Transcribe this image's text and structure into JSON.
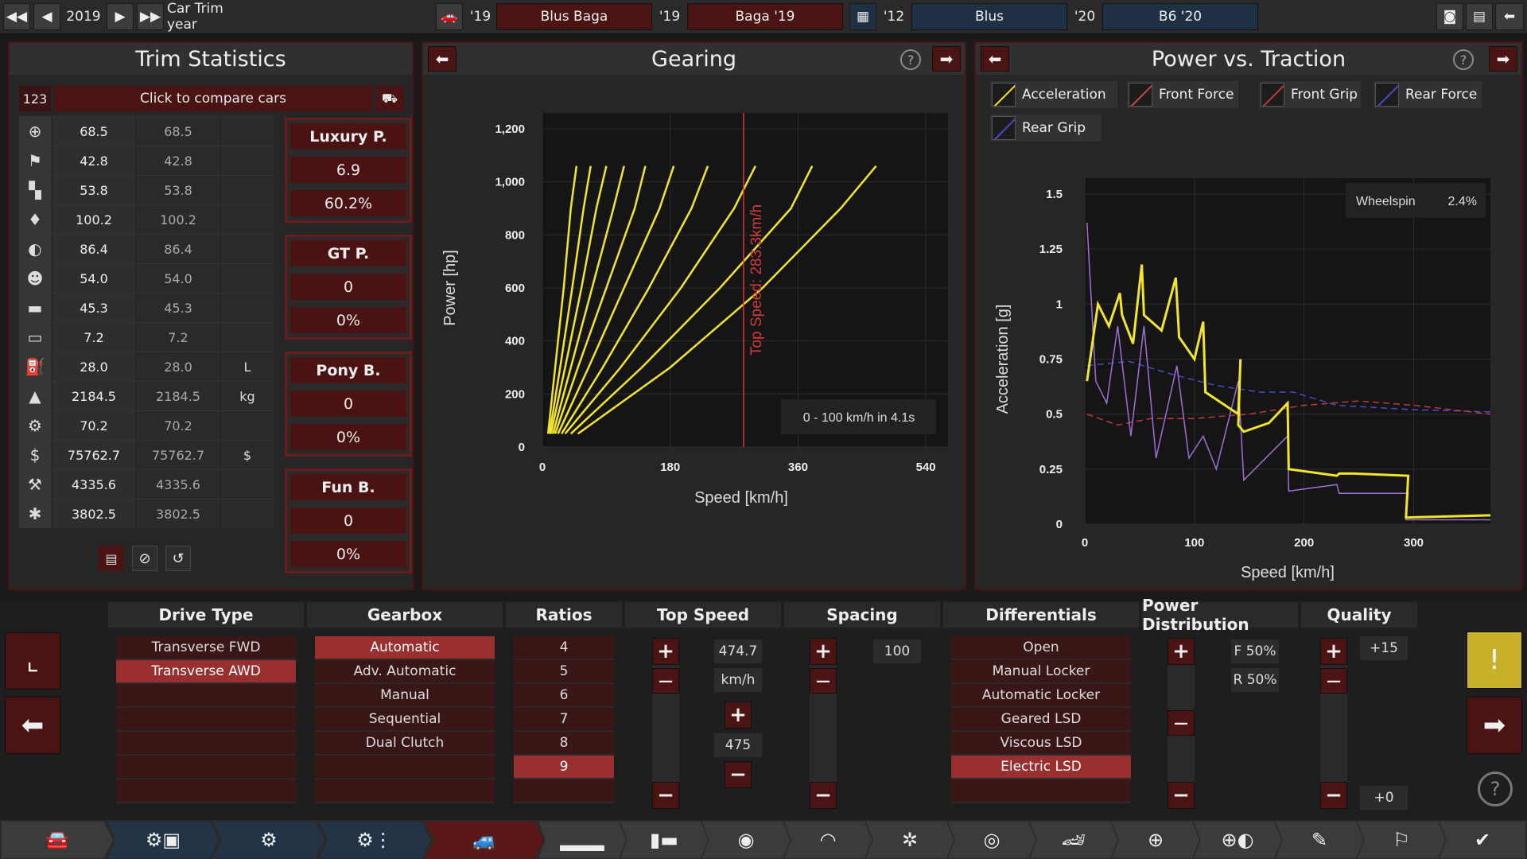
{
  "topbar": {
    "year": "2019",
    "year_label": "Car Trim year",
    "car_year_a": "'19",
    "model": "Blus Baga",
    "trim_year_a": "'19",
    "trim": "Baga '19",
    "engine_year": "'12",
    "engine_family": "Blus",
    "engine_variant_year": "'20",
    "engine_variant": "B6 '20"
  },
  "trim_stats": {
    "title": "Trim Statistics",
    "compare_id": "123",
    "compare_label": "Click to compare cars",
    "rows": [
      {
        "icon": "steering-wheel-icon",
        "glyph": "⊕",
        "v1": "68.5",
        "v2": "68.5",
        "unit": ""
      },
      {
        "icon": "race-flag-icon",
        "glyph": "⚑",
        "v1": "42.8",
        "v2": "42.8",
        "unit": ""
      },
      {
        "icon": "seat-icon",
        "glyph": "▚",
        "v1": "53.8",
        "v2": "53.8",
        "unit": ""
      },
      {
        "icon": "diamond-icon",
        "glyph": "♦",
        "v1": "100.2",
        "v2": "100.2",
        "unit": ""
      },
      {
        "icon": "safety-icon",
        "glyph": "◐",
        "v1": "86.4",
        "v2": "86.4",
        "unit": ""
      },
      {
        "icon": "passengers-icon",
        "glyph": "☻",
        "v1": "54.0",
        "v2": "54.0",
        "unit": ""
      },
      {
        "icon": "cargo-car-icon",
        "glyph": "▬",
        "v1": "45.3",
        "v2": "45.3",
        "unit": ""
      },
      {
        "icon": "offroad-car-icon",
        "glyph": "▭",
        "v1": "7.2",
        "v2": "7.2",
        "unit": ""
      },
      {
        "icon": "fuel-icon",
        "glyph": "⛽",
        "v1": "28.0",
        "v2": "28.0",
        "unit": "L"
      },
      {
        "icon": "weight-icon",
        "glyph": "▲",
        "v1": "2184.5",
        "v2": "2184.5",
        "unit": "kg"
      },
      {
        "icon": "service-icon",
        "glyph": "⚙",
        "v1": "70.2",
        "v2": "70.2",
        "unit": ""
      },
      {
        "icon": "cost-icon",
        "glyph": "$",
        "v1": "75762.7",
        "v2": "75762.7",
        "unit": "$"
      },
      {
        "icon": "production-icon",
        "glyph": "⚒",
        "v1": "4335.6",
        "v2": "4335.6",
        "unit": ""
      },
      {
        "icon": "engineering-icon",
        "glyph": "✱",
        "v1": "3802.5",
        "v2": "3802.5",
        "unit": ""
      }
    ],
    "categories": [
      {
        "name": "Luxury P.",
        "value": "6.9",
        "pct": "60.2%"
      },
      {
        "name": "GT P.",
        "value": "0",
        "pct": "0%"
      },
      {
        "name": "Pony B.",
        "value": "0",
        "pct": "0%"
      },
      {
        "name": "Fun B.",
        "value": "0",
        "pct": "0%"
      }
    ]
  },
  "gearing": {
    "title": "Gearing",
    "info": "0 - 100 km/h in 4.1s",
    "top_speed_label": "Top Speed: 283.3km/h"
  },
  "traction": {
    "title": "Power vs. Traction",
    "wheelspin_label": "Wheelspin",
    "wheelspin_value": "2.4%"
  },
  "chart_data": [
    {
      "type": "line",
      "title": "Gearing",
      "xlabel": "Speed [km/h]",
      "ylabel": "Power [hp]",
      "xlim": [
        0,
        560
      ],
      "ylim": [
        0,
        1200
      ],
      "xticks": [
        "0",
        "180",
        "360",
        "540"
      ],
      "yticks": [
        "0",
        "200",
        "400",
        "600",
        "800",
        "1,000",
        "1,200"
      ],
      "top_speed_line": 283.3,
      "series_color": "#f2e52a",
      "series": [
        {
          "x": [
            8,
            18,
            30,
            40,
            48
          ],
          "y": [
            50,
            300,
            600,
            900,
            1060
          ]
        },
        {
          "x": [
            10,
            25,
            42,
            58,
            68
          ],
          "y": [
            50,
            300,
            600,
            900,
            1060
          ]
        },
        {
          "x": [
            12,
            32,
            55,
            76,
            90
          ],
          "y": [
            50,
            300,
            600,
            900,
            1060
          ]
        },
        {
          "x": [
            15,
            40,
            70,
            100,
            115
          ],
          "y": [
            50,
            300,
            600,
            900,
            1060
          ]
        },
        {
          "x": [
            18,
            50,
            90,
            130,
            145
          ],
          "y": [
            50,
            300,
            600,
            900,
            1060
          ]
        },
        {
          "x": [
            22,
            65,
            115,
            165,
            185
          ],
          "y": [
            50,
            300,
            600,
            900,
            1060
          ]
        },
        {
          "x": [
            27,
            85,
            150,
            210,
            233
          ],
          "y": [
            50,
            300,
            600,
            900,
            1060
          ]
        },
        {
          "x": [
            32,
            110,
            195,
            270,
            300
          ],
          "y": [
            50,
            300,
            600,
            900,
            1060
          ]
        },
        {
          "x": [
            40,
            140,
            250,
            350,
            380
          ],
          "y": [
            50,
            300,
            600,
            900,
            1060
          ]
        },
        {
          "x": [
            50,
            180,
            310,
            420,
            470
          ],
          "y": [
            50,
            300,
            600,
            900,
            1060
          ]
        }
      ]
    },
    {
      "type": "line",
      "title": "Power vs. Traction",
      "xlabel": "Speed [km/h]",
      "ylabel": "Acceleration [g]",
      "xlim": [
        0,
        370
      ],
      "ylim": [
        0,
        1.5
      ],
      "xticks": [
        "0",
        "100",
        "200",
        "300"
      ],
      "yticks": [
        "0",
        "0.25",
        "0.5",
        "0.75",
        "1",
        "1.25",
        "1.5"
      ],
      "legend": [
        {
          "name": "Acceleration",
          "color": "#f2e52a"
        },
        {
          "name": "Front Force",
          "color": "#d04545"
        },
        {
          "name": "Front Grip",
          "color": "#c03a3a"
        },
        {
          "name": "Rear Force",
          "color": "#4a4ad0"
        },
        {
          "name": "Rear Grip",
          "color": "#4a4ad0"
        }
      ],
      "series": [
        {
          "name": "Acceleration",
          "color": "#f2e52a",
          "x": [
            2,
            12,
            22,
            32,
            34,
            44,
            52,
            54,
            70,
            83,
            86,
            100,
            108,
            110,
            140,
            142,
            140,
            145,
            168,
            185,
            186,
            230,
            232,
            245,
            295,
            293,
            370
          ],
          "y": [
            0.65,
            1.0,
            0.9,
            1.05,
            0.95,
            0.82,
            1.18,
            0.95,
            0.88,
            1.12,
            0.85,
            0.75,
            0.92,
            0.6,
            0.5,
            0.75,
            0.45,
            0.42,
            0.46,
            0.55,
            0.25,
            0.22,
            0.23,
            0.23,
            0.22,
            0.03,
            0.04
          ]
        },
        {
          "name": "Rear Grip",
          "color": "#4a4ad0",
          "x": [
            2,
            40,
            80,
            120,
            160,
            190,
            230,
            300,
            370
          ],
          "y": [
            0.72,
            0.74,
            0.68,
            0.63,
            0.6,
            0.6,
            0.54,
            0.52,
            0.51
          ]
        },
        {
          "name": "Front Grip",
          "color": "#c03a3a",
          "x": [
            2,
            30,
            60,
            100,
            150,
            200,
            250,
            300,
            370
          ],
          "y": [
            0.5,
            0.45,
            0.48,
            0.48,
            0.5,
            0.54,
            0.56,
            0.54,
            0.5
          ]
        },
        {
          "name": "Rear Force",
          "color": "#9f6fd8",
          "x": [
            2,
            10,
            20,
            30,
            42,
            54,
            65,
            84,
            95,
            108,
            120,
            140,
            145,
            185,
            186,
            230,
            232,
            295,
            293,
            370
          ],
          "y": [
            1.37,
            0.65,
            0.55,
            0.9,
            0.4,
            0.9,
            0.3,
            0.72,
            0.3,
            0.4,
            0.25,
            0.65,
            0.2,
            0.4,
            0.15,
            0.18,
            0.14,
            0.14,
            0.02,
            0.02
          ]
        }
      ]
    }
  ],
  "bottom": {
    "columns": {
      "drive_type": "Drive Type",
      "gearbox": "Gearbox",
      "ratios": "Ratios",
      "top_speed": "Top Speed",
      "spacing": "Spacing",
      "differentials": "Differentials",
      "power_distribution": "Power Distribution",
      "quality": "Quality"
    },
    "drive_types": [
      "Transverse FWD",
      "Transverse AWD"
    ],
    "drive_selected": 1,
    "gearboxes": [
      "Automatic",
      "Adv. Automatic",
      "Manual",
      "Sequential",
      "Dual Clutch"
    ],
    "gearbox_selected": 0,
    "ratios": [
      "4",
      "5",
      "6",
      "7",
      "8",
      "9"
    ],
    "ratio_selected": 5,
    "top_speed": {
      "value": "474.7",
      "unit": "km/h",
      "target": "475"
    },
    "spacing": {
      "value": "100"
    },
    "differentials": [
      "Open",
      "Manual Locker",
      "Automatic Locker",
      "Geared LSD",
      "Viscous LSD",
      "Electric LSD"
    ],
    "diff_selected": 5,
    "power_distribution": {
      "front": "F 50%",
      "rear": "R 50%"
    },
    "quality": {
      "top": "+15",
      "bottom": "+0"
    }
  },
  "colors": {
    "accent_red": "#4a1414",
    "selected_red": "#9a2f2f",
    "nav_blue": "#243447",
    "warning_yellow": "#c8b12a"
  }
}
